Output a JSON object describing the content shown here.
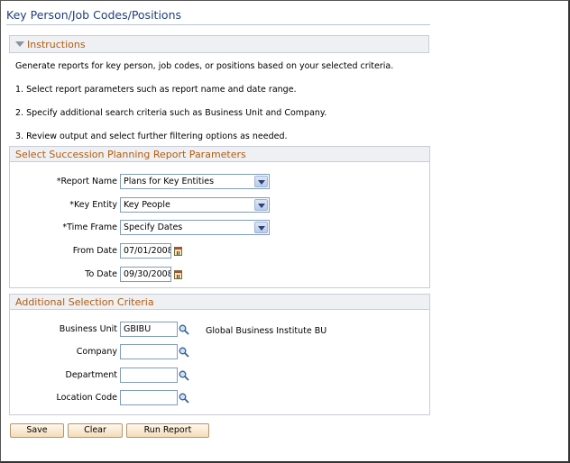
{
  "page": {
    "title": "Key Person/Job Codes/Positions"
  },
  "instructions": {
    "header": "Instructions",
    "lines": [
      "Generate reports for key person, job codes, or positions based on your selected criteria.",
      "1. Select report parameters such as report name and date range.",
      "2. Specify additional search criteria such as Business Unit and Company.",
      "3. Review output and select further filtering options as needed."
    ]
  },
  "report_params": {
    "header": "Select Succession Planning Report Parameters",
    "report_name": {
      "label": "*Report Name",
      "value": "Plans for Key Entities"
    },
    "key_entity": {
      "label": "*Key Entity",
      "value": "Key People"
    },
    "time_frame": {
      "label": "*Time Frame",
      "value": "Specify Dates"
    },
    "from_date": {
      "label": "From Date",
      "value": "07/01/2008"
    },
    "to_date": {
      "label": "To Date",
      "value": "09/30/2008"
    }
  },
  "additional": {
    "header": "Additional Selection Criteria",
    "business_unit": {
      "label": "Business Unit",
      "value": "GBIBU",
      "description": "Global Business Institute BU"
    },
    "company": {
      "label": "Company",
      "value": ""
    },
    "department": {
      "label": "Department",
      "value": ""
    },
    "location_code": {
      "label": "Location Code",
      "value": ""
    }
  },
  "buttons": {
    "save": "Save",
    "clear": "Clear",
    "run_report": "Run Report"
  },
  "colors": {
    "title": "#1f3f7a",
    "section_header": "#b25c0e",
    "button_bg": "#f5dcb9"
  },
  "icons": {
    "collapse": "triangle-down-icon",
    "calendar": "calendar-icon",
    "lookup": "magnifier-icon"
  }
}
